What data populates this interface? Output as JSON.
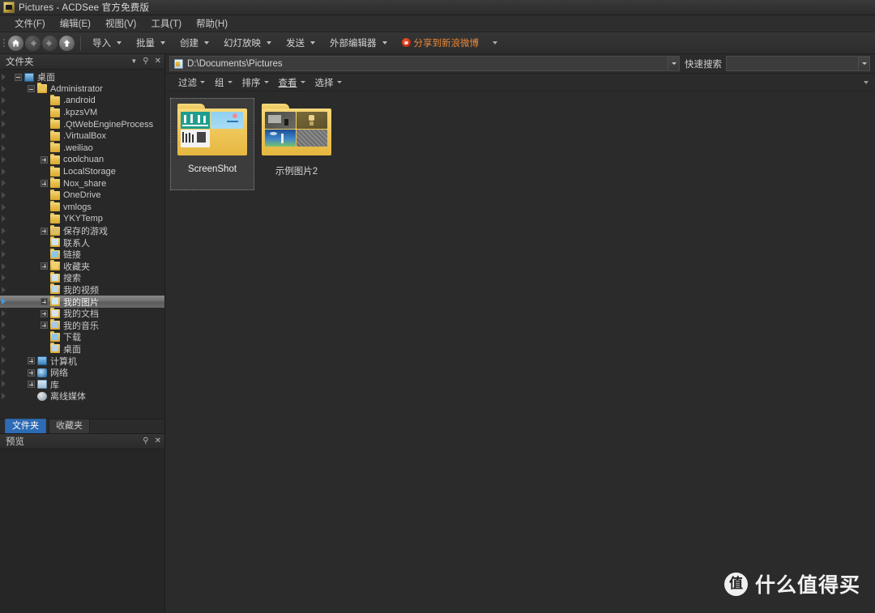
{
  "window": {
    "title": "Pictures - ACDSee 官方免费版",
    "app_icon": "acdsee-app-icon"
  },
  "menubar": {
    "items": [
      {
        "label": "文件(F)"
      },
      {
        "label": "编辑(E)"
      },
      {
        "label": "视图(V)"
      },
      {
        "label": "工具(T)"
      },
      {
        "label": "帮助(H)"
      }
    ]
  },
  "toolbar": {
    "nav": [
      {
        "name": "home-icon",
        "enabled": true
      },
      {
        "name": "back-icon",
        "enabled": false
      },
      {
        "name": "forward-icon",
        "enabled": false
      },
      {
        "name": "up-icon",
        "enabled": true
      }
    ],
    "buttons": [
      {
        "label": "导入"
      },
      {
        "label": "批量"
      },
      {
        "label": "创建"
      },
      {
        "label": "幻灯放映"
      },
      {
        "label": "发送"
      },
      {
        "label": "外部编辑器"
      }
    ],
    "share": {
      "label": "分享到新浪微博",
      "color": "#e8883a"
    },
    "overflow": "toolbar-overflow-icon"
  },
  "folders_panel": {
    "title": "文件夹",
    "header_icons": [
      "chevron-down-icon",
      "pin-icon",
      "close-icon"
    ],
    "tree": [
      {
        "label": "桌面",
        "indent": 0,
        "expander": "minus",
        "icon": "monitor",
        "selected": false
      },
      {
        "label": "Administrator",
        "indent": 1,
        "expander": "minus",
        "icon": "folder-user",
        "selected": false
      },
      {
        "label": ".android",
        "indent": 2,
        "expander": "none",
        "icon": "folder",
        "selected": false
      },
      {
        "label": ".kpzsVM",
        "indent": 2,
        "expander": "none",
        "icon": "folder",
        "selected": false
      },
      {
        "label": ".QtWebEngineProcess",
        "indent": 2,
        "expander": "none",
        "icon": "folder",
        "selected": false
      },
      {
        "label": ".VirtualBox",
        "indent": 2,
        "expander": "none",
        "icon": "folder",
        "selected": false
      },
      {
        "label": ".weiliao",
        "indent": 2,
        "expander": "none",
        "icon": "folder",
        "selected": false
      },
      {
        "label": "coolchuan",
        "indent": 2,
        "expander": "plus",
        "icon": "folder",
        "selected": false
      },
      {
        "label": "LocalStorage",
        "indent": 2,
        "expander": "none",
        "icon": "folder",
        "selected": false
      },
      {
        "label": "Nox_share",
        "indent": 2,
        "expander": "plus",
        "icon": "folder",
        "selected": false
      },
      {
        "label": "OneDrive",
        "indent": 2,
        "expander": "none",
        "icon": "folder",
        "selected": false
      },
      {
        "label": "vmlogs",
        "indent": 2,
        "expander": "none",
        "icon": "folder",
        "selected": false
      },
      {
        "label": "YKYTemp",
        "indent": 2,
        "expander": "none",
        "icon": "folder",
        "selected": false
      },
      {
        "label": "保存的游戏",
        "indent": 2,
        "expander": "plus",
        "icon": "folder-games",
        "selected": false
      },
      {
        "label": "联系人",
        "indent": 2,
        "expander": "none",
        "icon": "folder-contacts",
        "selected": false
      },
      {
        "label": "链接",
        "indent": 2,
        "expander": "none",
        "icon": "folder-links",
        "selected": false
      },
      {
        "label": "收藏夹",
        "indent": 2,
        "expander": "plus",
        "icon": "folder-favorites",
        "selected": false
      },
      {
        "label": "搜索",
        "indent": 2,
        "expander": "none",
        "icon": "folder-search",
        "selected": false
      },
      {
        "label": "我的视频",
        "indent": 2,
        "expander": "none",
        "icon": "folder-videos",
        "selected": false
      },
      {
        "label": "我的图片",
        "indent": 2,
        "expander": "plus",
        "icon": "folder-pictures",
        "selected": true
      },
      {
        "label": "我的文档",
        "indent": 2,
        "expander": "plus",
        "icon": "folder-documents",
        "selected": false
      },
      {
        "label": "我的音乐",
        "indent": 2,
        "expander": "plus",
        "icon": "folder-music",
        "selected": false
      },
      {
        "label": "下载",
        "indent": 2,
        "expander": "none",
        "icon": "folder-downloads",
        "selected": false
      },
      {
        "label": "桌面",
        "indent": 2,
        "expander": "none",
        "icon": "folder-desktop",
        "selected": false
      },
      {
        "label": "计算机",
        "indent": 1,
        "expander": "plus",
        "icon": "monitor",
        "selected": false
      },
      {
        "label": "网络",
        "indent": 1,
        "expander": "plus",
        "icon": "network",
        "selected": false
      },
      {
        "label": "库",
        "indent": 1,
        "expander": "plus",
        "icon": "library",
        "selected": false
      },
      {
        "label": "离线媒体",
        "indent": 1,
        "expander": "none",
        "icon": "media",
        "selected": false
      }
    ],
    "tabs": [
      {
        "label": "文件夹",
        "active": true
      },
      {
        "label": "收藏夹",
        "active": false
      }
    ]
  },
  "preview_panel": {
    "title": "预览",
    "header_icons": [
      "pin-icon",
      "close-icon"
    ]
  },
  "address_bar": {
    "path": "D:\\Documents\\Pictures",
    "path_icon": "folder-path-icon",
    "dropdown_icon": "chevron-down-icon",
    "search_label": "快速搜索",
    "search_value": "",
    "search_placeholder": "",
    "search_dropdown_icon": "chevron-down-icon"
  },
  "filter_bar": {
    "buttons": [
      {
        "label": "过滤",
        "underline": false
      },
      {
        "label": "组",
        "underline": false
      },
      {
        "label": "排序",
        "underline": false
      },
      {
        "label": "查看",
        "underline": true
      },
      {
        "label": "选择",
        "underline": false
      }
    ],
    "overflow_icon": "chevron-down-icon"
  },
  "content": {
    "items": [
      {
        "label": "ScreenShot",
        "selected": true,
        "thumb_style": "screenshot"
      },
      {
        "label": "示例图片2",
        "selected": false,
        "thumb_style": "samples"
      }
    ]
  },
  "watermark": {
    "badge": "值",
    "text": "什么值得买"
  }
}
